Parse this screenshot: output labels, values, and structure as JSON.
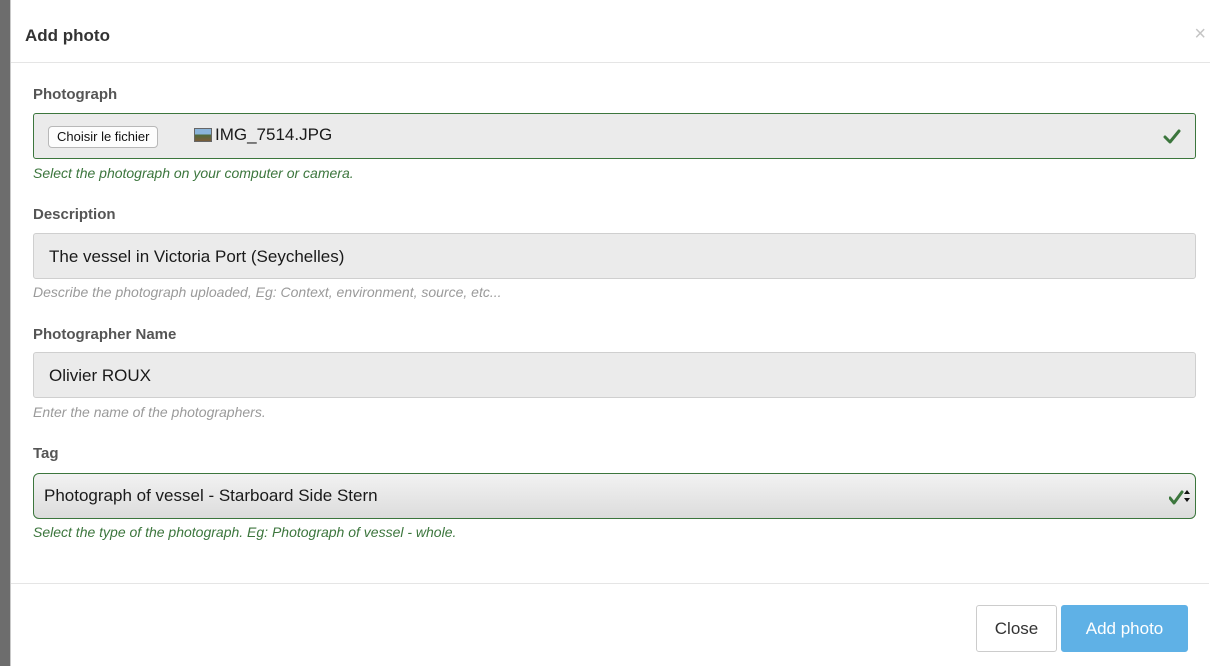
{
  "modal": {
    "title": "Add photo",
    "close_symbol": "×"
  },
  "photograph": {
    "label": "Photograph",
    "file_button": "Choisir le fichier",
    "file_name": "IMG_7514.JPG",
    "help": "Select the photograph on your computer or camera.",
    "state": "success"
  },
  "description": {
    "label": "Description",
    "value": "The vessel in Victoria Port (Seychelles)",
    "help": "Describe the photograph uploaded, Eg: Context, environment, source, etc..."
  },
  "photographer": {
    "label": "Photographer Name",
    "value": "Olivier ROUX",
    "help": "Enter the name of the photographers."
  },
  "tag": {
    "label": "Tag",
    "selected": "Photograph of vessel - Starboard Side Stern",
    "help": "Select the type of the photograph. Eg: Photograph of vessel - whole.",
    "state": "success"
  },
  "footer": {
    "close_label": "Close",
    "add_label": "Add photo"
  },
  "colors": {
    "success": "#3c763d",
    "primary_button": "#5fb1e6"
  },
  "icons": [
    "close-icon",
    "checkmark-icon",
    "image-file-icon",
    "select-arrows-icon"
  ]
}
